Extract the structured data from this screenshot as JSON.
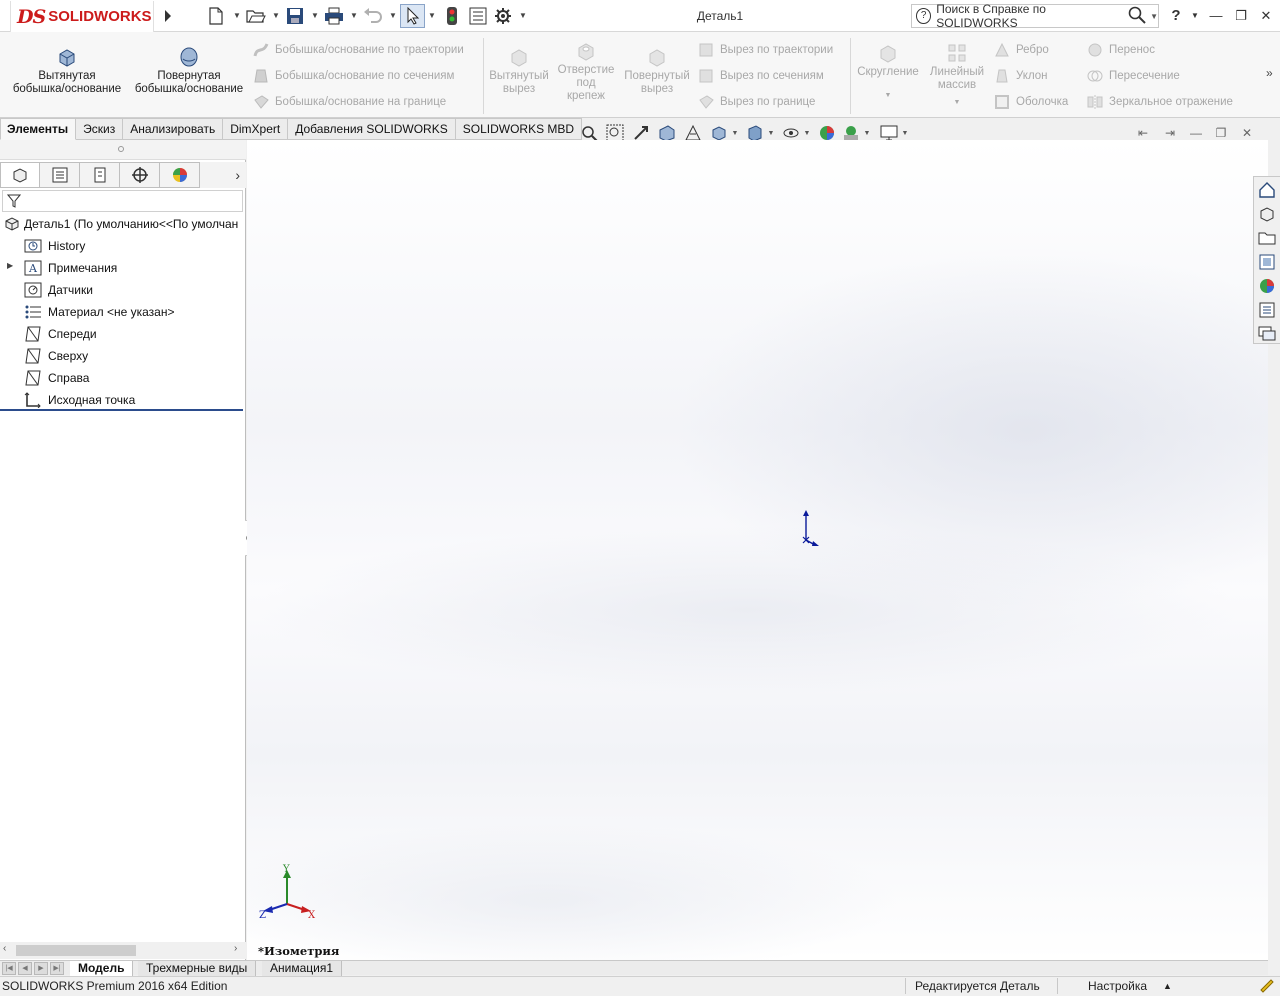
{
  "titlebar": {
    "logo_ds": "DS",
    "logo_text": "SOLIDWORKS",
    "document_title": "Деталь1",
    "search_placeholder": "Поиск в Справке по SOLIDWORKS",
    "help": "?"
  },
  "ribbon": {
    "extruded_boss": "Вытянутая\nбобышка/основание",
    "revolved_boss": "Повернутая\nбобышка/основание",
    "swept_boss": "Бобышка/основание по траектории",
    "lofted_boss": "Бобышка/основание по сечениям",
    "boundary_boss": "Бобышка/основание на границе",
    "extruded_cut": "Вытянутый\nвырез",
    "hole_wizard": "Отверстие\nпод\nкрепеж",
    "revolved_cut": "Повернутый\nвырез",
    "swept_cut": "Вырез по траектории",
    "lofted_cut": "Вырез по сечениям",
    "boundary_cut": "Вырез по границе",
    "fillet": "Скругление",
    "linear_pattern": "Линейный\nмассив",
    "rib": "Ребро",
    "draft": "Уклон",
    "shell": "Оболочка",
    "wrap": "Перенос",
    "intersect": "Пересечение",
    "mirror": "Зеркальное отражение"
  },
  "command_tabs": [
    "Элементы",
    "Эскиз",
    "Анализировать",
    "DimXpert",
    "Добавления SOLIDWORKS",
    "SOLIDWORKS MBD"
  ],
  "feature_tree": {
    "root": "Деталь1  (По умолчанию<<По умолчан",
    "items": [
      "History",
      "Примечания",
      "Датчики",
      "Материал <не указан>",
      "Спереди",
      "Сверху",
      "Справа",
      "Исходная точка"
    ]
  },
  "viewport": {
    "view_label": "*Изометрия",
    "triad": {
      "x": "X",
      "y": "Y",
      "z": "Z"
    }
  },
  "bottom_tabs": [
    "Модель",
    "Трехмерные виды",
    "Анимация1"
  ],
  "statusbar": {
    "product": "SOLIDWORKS Premium 2016 x64 Edition",
    "editing": "Редактируется Деталь",
    "custom": "Настройка"
  },
  "colors": {
    "brand_red": "#cc1b1b",
    "tree_accent": "#2b4c8c",
    "disabled_text": "#a8a8a8"
  }
}
